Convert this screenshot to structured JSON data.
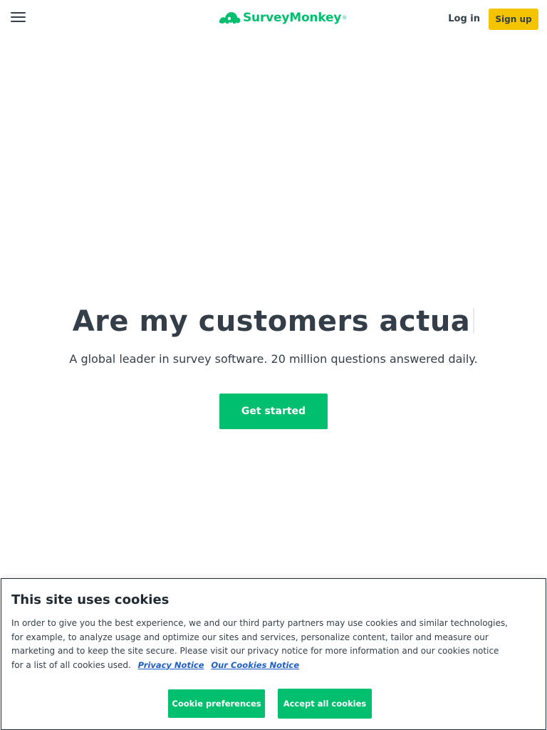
{
  "header": {
    "menu_icon": "hamburger-menu-icon",
    "logo_icon": "surveymonkey-logo-icon",
    "logo_text": "SurveyMonkey",
    "logo_reg": "®",
    "login_label": "Log in",
    "signup_label": "Sign up"
  },
  "hero": {
    "title": "Are my customers actua",
    "subtitle": "A global leader in survey software. 20 million questions answered daily.",
    "cta_label": "Get started"
  },
  "cookie": {
    "title": "This site uses cookies",
    "body": "In order to give you the best experience, we and our third party partners may use cookies and similar technologies, for example, to analyze usage and optimize our sites and services, personalize content, tailor and measure our marketing and to keep the site secure. Please visit our privacy notice for more information and our cookies notice for a list of all cookies used.",
    "privacy_link": "Privacy Notice",
    "cookies_link": "Our Cookies Notice",
    "preferences_label": "Cookie preferences",
    "accept_label": "Accept all cookies"
  },
  "colors": {
    "brand_green": "#00bf6f",
    "signup_yellow": "#f4c400",
    "text_dark": "#333e48",
    "link_blue": "#1d5ec8"
  }
}
